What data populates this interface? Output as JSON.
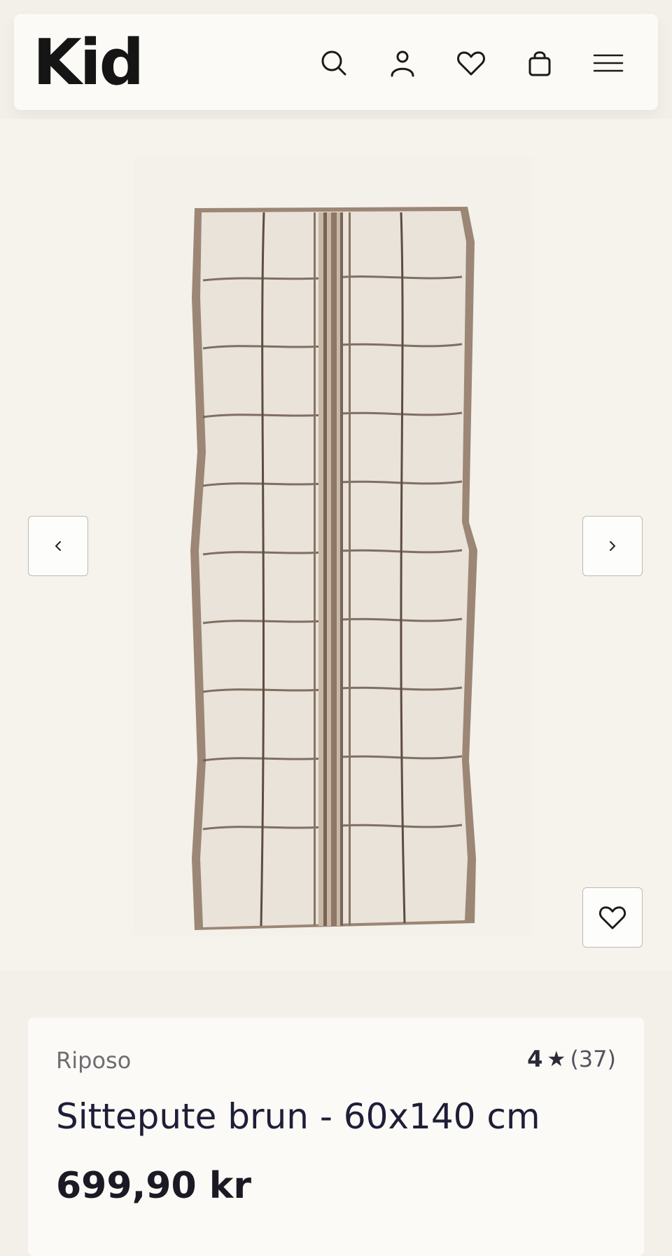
{
  "header": {
    "logo": "Kid",
    "icons": [
      "search-icon",
      "user-icon",
      "heart-icon",
      "bag-icon",
      "menu-icon"
    ]
  },
  "gallery": {
    "product_image": "striped seat cushion"
  },
  "product": {
    "brand": "Riposo",
    "rating_score": "4",
    "rating_star": "★",
    "rating_count": "(37)",
    "title": "Sittepute brun - 60x140 cm",
    "price": "699,90 kr"
  },
  "colors": {
    "page_bg": "#f3f0ea",
    "header_bg": "#fbfaf6",
    "cushion": "#e8e2d9",
    "stripe": "#8a7462",
    "text": "#1f1e2a"
  }
}
